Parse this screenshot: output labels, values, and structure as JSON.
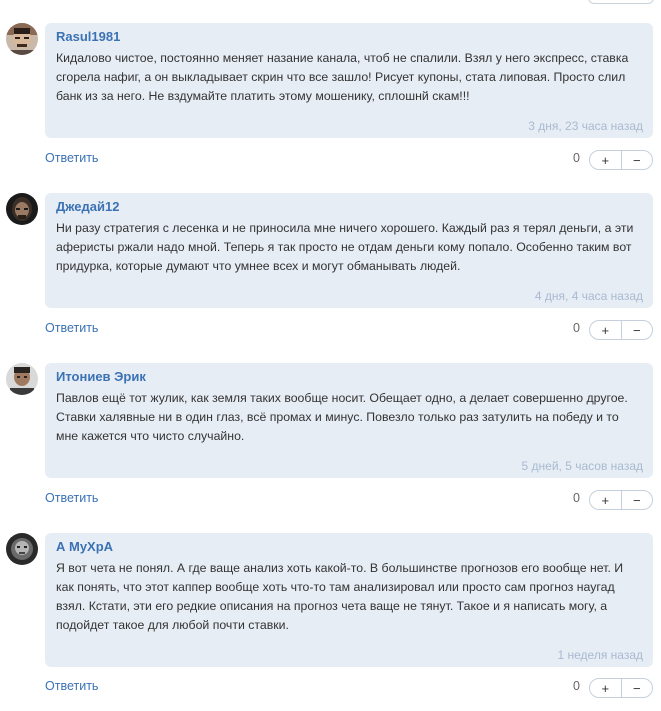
{
  "comments": [
    {
      "author": "Rasul1981",
      "avatar_icon": "user-avatar",
      "text": "Кидалово чистое, постоянно меняет назание канала, чтоб не спалили. Взял у него экспресс, ставка сгорела нафиг, а он выкладывает скрин что все зашло! Рисует купоны, стата липовая. Просто слил банк из за него. Не вздумайте платить этому мошенику, сплошнй скам!!!",
      "time": "3 дня, 23 часа назад",
      "reply_label": "Ответить",
      "score": "0",
      "plus_label": "+",
      "minus_label": "−"
    },
    {
      "author": "Джедай12",
      "avatar_icon": "user-avatar",
      "text": "Ни разу стратегия с лесенка и не приносила мне ничего хорошего. Каждый раз я терял деньги, а эти аферисты ржали надо мной. Теперь я так просто не отдам деньги кому попало. Особенно таким вот придурка, которые думают что умнее всех и могут обманывать людей.",
      "time": "4 дня, 4 часа назад",
      "reply_label": "Ответить",
      "score": "0",
      "plus_label": "+",
      "minus_label": "−"
    },
    {
      "author": "Итониев Эрик",
      "avatar_icon": "user-avatar",
      "text": "Павлов ещё тот жулик, как земля таких вообще носит. Обещает одно, а делает совершенно другое. Ставки халявные ни в один глаз, всё промах и минус. Повезло только раз затулить на победу и то мне кажется что чисто случайно.",
      "time": "5 дней, 5 часов назад",
      "reply_label": "Ответить",
      "score": "0",
      "plus_label": "+",
      "minus_label": "−"
    },
    {
      "author": "А МуХрА",
      "avatar_icon": "user-avatar",
      "text": "Я вот чета не понял. А где ваще анализ хоть какой-то. В большинстве прогнозов его вообще нет. И как понять, что этот каппер вообще хоть что-то там анализировал или просто сам прогноз наугад взял. Кстати, эти его редкие описания на прогноз чета ваще не тянут. Такое и я написать могу, а подойдет такое для любой почти ставки.",
      "time": "1 неделя назад",
      "reply_label": "Ответить",
      "score": "0",
      "plus_label": "+",
      "minus_label": "−"
    }
  ]
}
